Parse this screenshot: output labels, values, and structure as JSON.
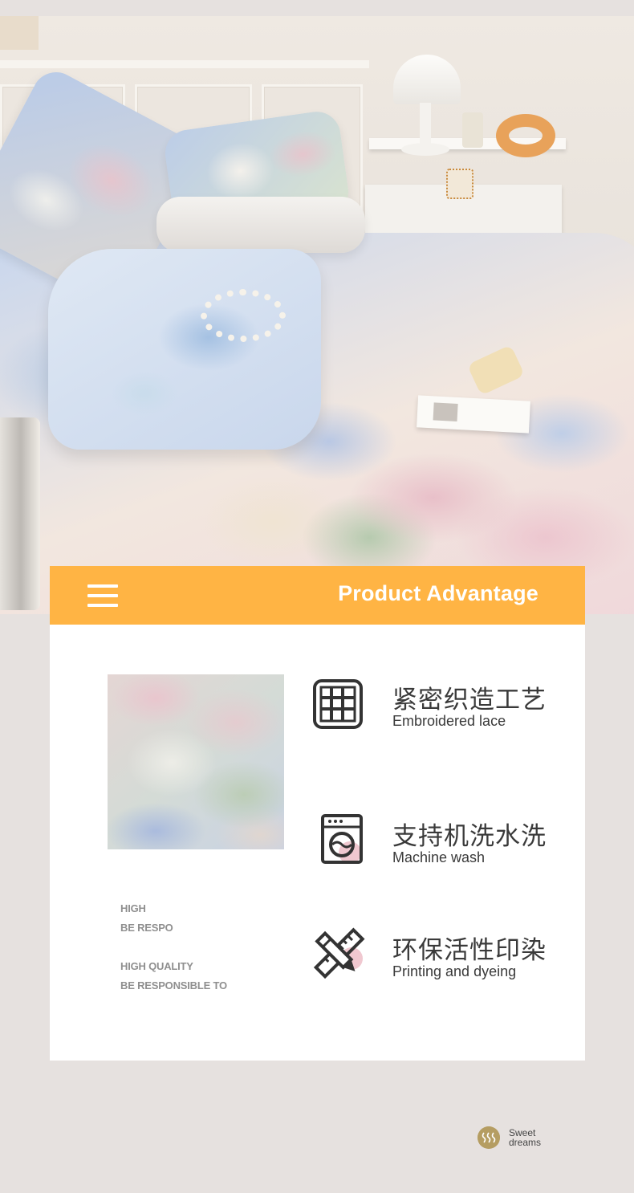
{
  "header": {
    "title": "Product Advantage",
    "menu_icon": "hamburger-menu-icon",
    "color": "#ffb444"
  },
  "features": [
    {
      "icon": "grid-weave-icon",
      "title_cn": "紧密织造工艺",
      "title_en": "Embroidered lace"
    },
    {
      "icon": "washing-machine-icon",
      "title_cn": "支持机洗水洗",
      "title_en": "Machine wash"
    },
    {
      "icon": "pencil-ruler-icon",
      "title_cn": "环保活性印染",
      "title_en": "Printing and dyeing"
    }
  ],
  "decorative_text": [
    "HIGH",
    "BE RESPO",
    "HIGH QUALITY",
    "BE RESPONSIBLE TO"
  ],
  "logo": {
    "line1": "Sweet",
    "line2": "dreams"
  },
  "colors": {
    "accent": "#ffb444",
    "page_bg": "#e6e1df",
    "card_bg": "#ffffff",
    "text_dark": "#3a3a3a",
    "text_gray": "#8f8f8f",
    "logo_gold": "#b59d62"
  }
}
